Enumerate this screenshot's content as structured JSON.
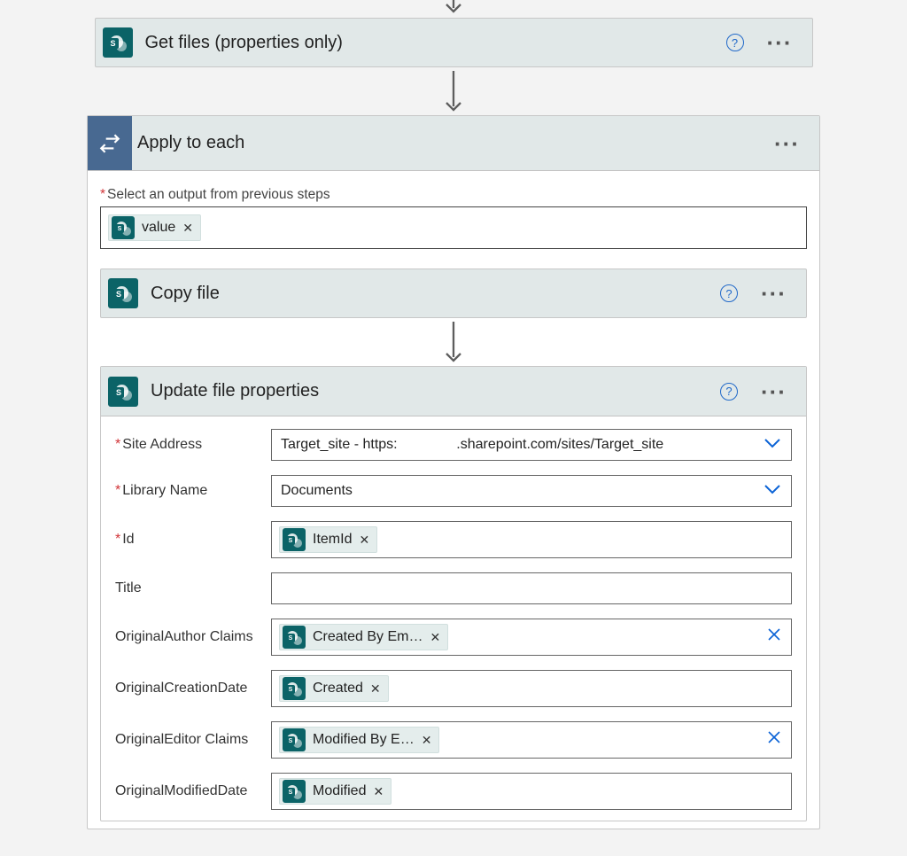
{
  "arrow_in_visible": true,
  "actions": {
    "get_files": {
      "title": "Get files (properties only)",
      "has_help": true
    },
    "apply_to_each": {
      "title": "Apply to each",
      "output_label": "Select an output from previous steps",
      "output_token": "value"
    },
    "copy_file": {
      "title": "Copy file",
      "has_help": true
    },
    "update_file": {
      "title": "Update file properties",
      "has_help": true,
      "fields": {
        "site_address": {
          "label": "Site Address",
          "required": true,
          "type": "select",
          "value": "Target_site - https:               .sharepoint.com/sites/Target_site"
        },
        "library_name": {
          "label": "Library Name",
          "required": true,
          "type": "select",
          "value": "Documents"
        },
        "id": {
          "label": "Id",
          "required": true,
          "type": "token",
          "token": "ItemId"
        },
        "title": {
          "label": "Title",
          "required": false,
          "type": "text",
          "value": ""
        },
        "original_author": {
          "label": "OriginalAuthor Claims",
          "required": false,
          "type": "token_clear",
          "token": "Created By Em…"
        },
        "original_creation": {
          "label": "OriginalCreationDate",
          "required": false,
          "type": "token",
          "token": "Created"
        },
        "original_editor": {
          "label": "OriginalEditor Claims",
          "required": false,
          "type": "token_clear",
          "token": "Modified By E…"
        },
        "original_modified": {
          "label": "OriginalModifiedDate",
          "required": false,
          "type": "token",
          "token": "Modified"
        }
      }
    }
  }
}
